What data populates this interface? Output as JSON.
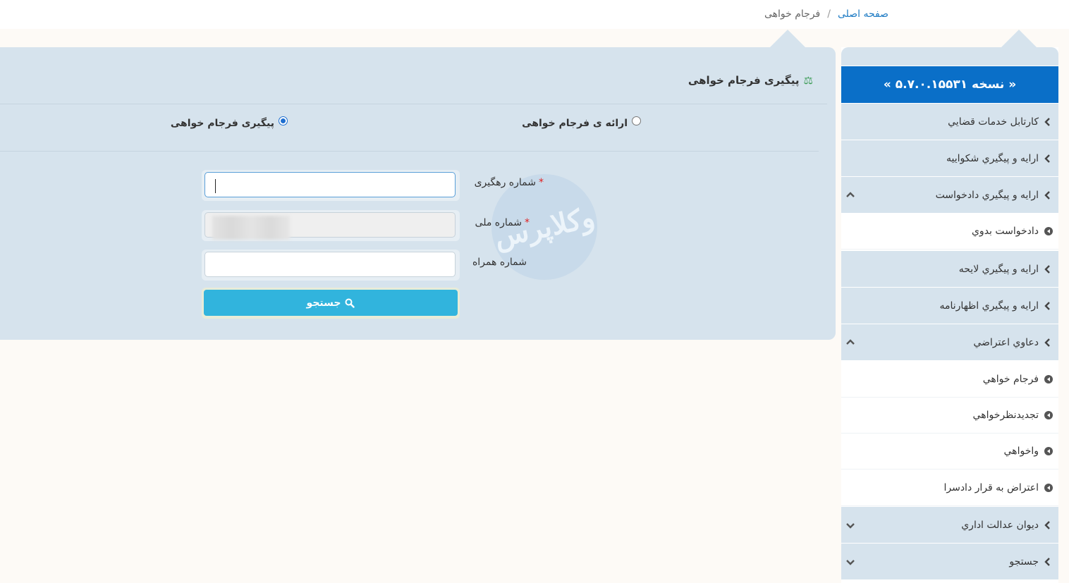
{
  "breadcrumb": {
    "home": "صفحه اصلی",
    "separator": "/",
    "current": "فرجام خواهی"
  },
  "panel": {
    "title": "پیگیری فرجام خواهی",
    "title_icon": "balance-scale-icon"
  },
  "radios": {
    "submit_label": "ارائه ی فرجام خواهی",
    "track_label": "پیگیری فرجام خواهی",
    "selected": "track"
  },
  "form": {
    "tracking_label": "شماره رهگیری",
    "national_id_label": "شماره ملی",
    "mobile_label": "شماره همراه",
    "required_mark": "*",
    "search_label": "جستجو",
    "search_icon": "search-icon"
  },
  "sidebar": {
    "version": "« نسخه ۵.۷.۰.۱۵۵۳۱ »",
    "items": [
      {
        "label": "کارتابل خدمات قضايي",
        "type": "parent",
        "toggle": ""
      },
      {
        "label": "ارايه و پيگيري شکواييه",
        "type": "parent",
        "toggle": ""
      },
      {
        "label": "ارايه و پيگيري دادخواست",
        "type": "parent",
        "toggle": "up"
      },
      {
        "label": "دادخواست بدوي",
        "type": "child",
        "toggle": ""
      },
      {
        "label": "ارايه و پيگيري لايحه",
        "type": "parent",
        "toggle": ""
      },
      {
        "label": "ارايه و پيگيري اظهارنامه",
        "type": "parent",
        "toggle": ""
      },
      {
        "label": "دعاوي اعتراضي",
        "type": "parent",
        "toggle": "up"
      },
      {
        "label": "فرجام خواهي",
        "type": "child",
        "toggle": ""
      },
      {
        "label": "تجديدنظرخواهي",
        "type": "child",
        "toggle": ""
      },
      {
        "label": "واخواهي",
        "type": "child",
        "toggle": ""
      },
      {
        "label": "اعتراض به قرار دادسرا",
        "type": "child",
        "toggle": ""
      },
      {
        "label": "ديوان عدالت اداري",
        "type": "parent",
        "toggle": "down"
      },
      {
        "label": "جستجو",
        "type": "parent",
        "toggle": "down"
      }
    ]
  },
  "colors": {
    "panel_bg": "#d6e3ed",
    "version_bar": "#0a6fc8",
    "search_button": "#31b4dd",
    "required": "#e02020",
    "link": "#1e7bc4"
  }
}
